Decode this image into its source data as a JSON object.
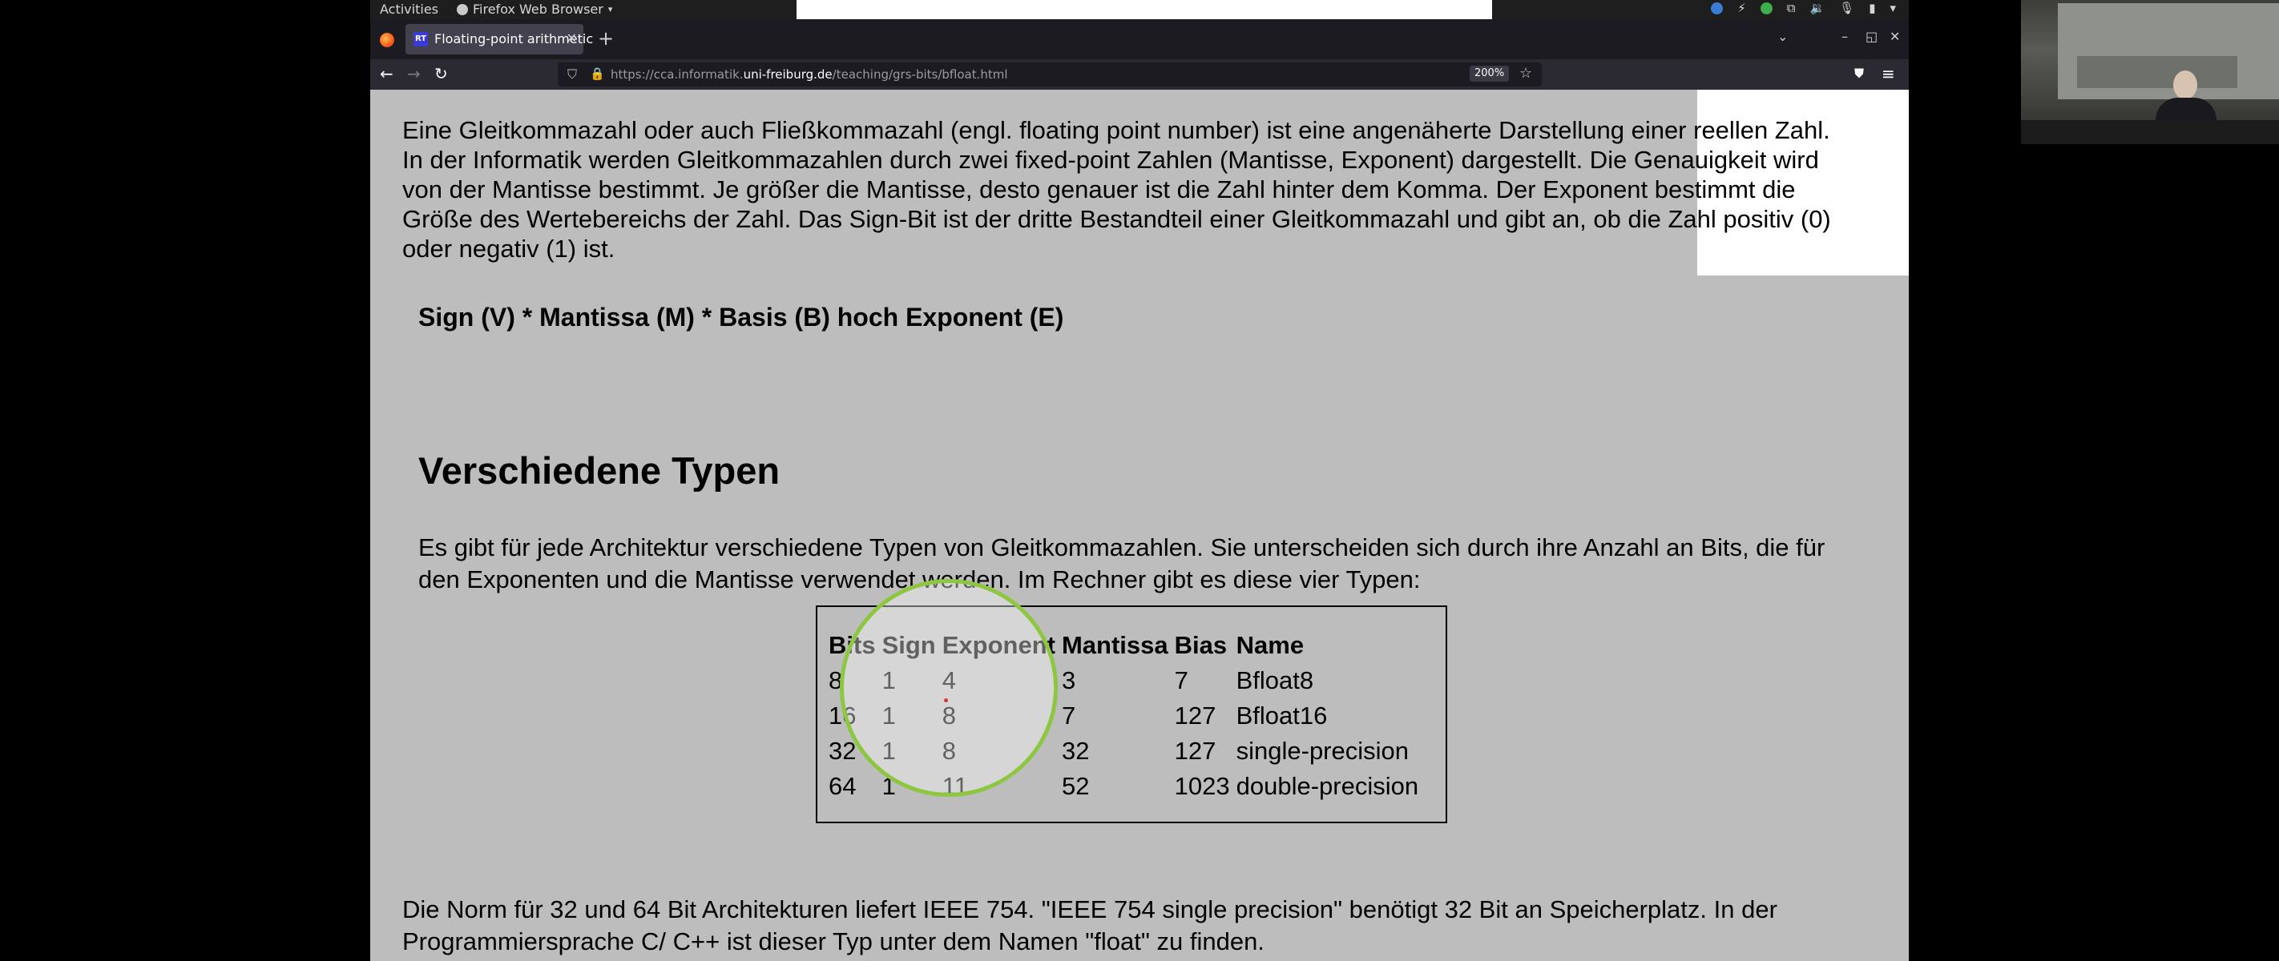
{
  "topbar": {
    "activities": "Activities",
    "app_menu": "Firefox Web Browser"
  },
  "browser": {
    "tab_title": "Floating-point arithmetic",
    "tab_favicon_text": "RT",
    "url_prefix": "https://cca.informatik.",
    "url_host": "uni-freiburg.de",
    "url_path": "/teaching/grs-bits/bfloat.html",
    "zoom": "200%"
  },
  "content": {
    "intro": "Eine Gleitkommazahl oder auch Fließkommazahl (engl. floating point number) ist eine angenäherte Darstellung einer reellen Zahl. In der Informatik werden Gleitkommazahlen durch zwei fixed-point Zahlen (Mantisse, Exponent) dargestellt. Die Genauigkeit wird von der Mantisse bestimmt. Je größer die Mantisse, desto genauer ist die Zahl hinter dem Komma. Der Exponent bestimmt die Größe des Wertebereichs der Zahl. Das Sign-Bit ist der dritte Bestandteil einer Gleitkommazahl und gibt an, ob die Zahl positiv (0) oder negativ (1) ist.",
    "formula": "Sign (V) * Mantissa (M) * Basis (B) hoch Exponent (E)",
    "heading": "Verschiedene Typen",
    "types_text": "Es gibt für jede Architektur verschiedene Typen von Gleitkommazahlen. Sie unterscheiden sich durch ihre Anzahl an Bits, die für den Exponenten und die Mantisse verwendet werden. Im Rechner gibt es diese vier Typen:",
    "table": {
      "headers": [
        "Bits",
        "Sign",
        "Exponent",
        "Mantissa",
        "Bias",
        "Name"
      ],
      "rows": [
        [
          "8",
          "1",
          "4",
          "3",
          "7",
          "Bfloat8"
        ],
        [
          "16",
          "1",
          "8",
          "7",
          "127",
          "Bfloat16"
        ],
        [
          "32",
          "1",
          "8",
          "32",
          "127",
          "single-precision"
        ],
        [
          "64",
          "1",
          "11",
          "52",
          "1023",
          "double-precision"
        ]
      ]
    },
    "ieee": "Die Norm für 32 und 64 Bit Architekturen liefert IEEE 754. \"IEEE 754 single precision\" benötigt 32 Bit an Speicherplatz. In der Programmiersprache C/ C++ ist dieser Typ unter dem Namen \"float\" zu finden."
  },
  "colors": {
    "page_background": "#bdbdbd",
    "spotlight_ring": "#8dc63f",
    "firefox_tab_active": "#42414d"
  },
  "icons": [
    "firefox-logo-icon",
    "close-icon",
    "plus-icon",
    "back-icon",
    "forward-icon",
    "reload-icon",
    "shield-icon",
    "lock-icon",
    "star-icon",
    "pocket-icon",
    "hamburger-menu-icon",
    "minimize-icon",
    "maximize-icon",
    "window-close-icon",
    "chevron-down-icon",
    "network-icon",
    "volume-icon",
    "microphone-icon",
    "battery-icon"
  ]
}
